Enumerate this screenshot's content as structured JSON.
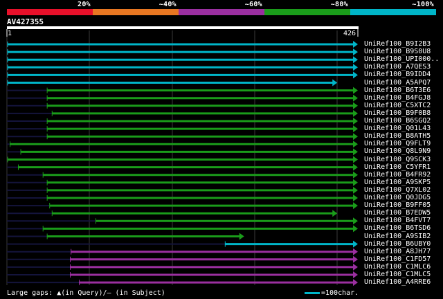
{
  "legend": {
    "segments": [
      {
        "label": "20%",
        "color": "#e8102a"
      },
      {
        "label": "~40%",
        "color": "#e87722"
      },
      {
        "label": "~60%",
        "color": "#9b2fa0"
      },
      {
        "label": "~80%",
        "color": "#1a9c1a"
      },
      {
        "label": "~100%",
        "color": "#00b5c8"
      }
    ]
  },
  "query": {
    "name": "AV427355",
    "start": "1",
    "end": "426"
  },
  "hits": [
    {
      "name": "UniRef100_B9I2B3",
      "color": "#00b5c8",
      "start": 1,
      "end": 426
    },
    {
      "name": "UniRef100_B9S0U8",
      "color": "#00b5c8",
      "start": 1,
      "end": 426
    },
    {
      "name": "UniRef100_UPI000..",
      "color": "#00b5c8",
      "start": 1,
      "end": 426
    },
    {
      "name": "UniRef100_A7QES3",
      "color": "#00b5c8",
      "start": 1,
      "end": 426
    },
    {
      "name": "UniRef100_B9IDD4",
      "color": "#00b5c8",
      "start": 1,
      "end": 426
    },
    {
      "name": "UniRef100_A5APQ7",
      "color": "#00b5c8",
      "start": 1,
      "end": 401
    },
    {
      "name": "UniRef100_B6T3E6",
      "color": "#1a9c1a",
      "start": 49,
      "end": 426
    },
    {
      "name": "UniRef100_B4FGJ8",
      "color": "#1a9c1a",
      "start": 49,
      "end": 426
    },
    {
      "name": "UniRef100_C5XTC2",
      "color": "#1a9c1a",
      "start": 49,
      "end": 426
    },
    {
      "name": "UniRef100_B9F0B8",
      "color": "#1a9c1a",
      "start": 55,
      "end": 426
    },
    {
      "name": "UniRef100_B6SGQ2",
      "color": "#1a9c1a",
      "start": 49,
      "end": 426
    },
    {
      "name": "UniRef100_Q01L43",
      "color": "#1a9c1a",
      "start": 49,
      "end": 426
    },
    {
      "name": "UniRef100_B8ATH5",
      "color": "#1a9c1a",
      "start": 49,
      "end": 426
    },
    {
      "name": "UniRef100_Q9FLT9",
      "color": "#1a9c1a",
      "start": 4,
      "end": 426
    },
    {
      "name": "UniRef100_Q8L9N9",
      "color": "#1a9c1a",
      "start": 17,
      "end": 426
    },
    {
      "name": "UniRef100_Q9SCK3",
      "color": "#1a9c1a",
      "start": 1,
      "end": 426
    },
    {
      "name": "UniRef100_C5YFR1",
      "color": "#1a9c1a",
      "start": 14,
      "end": 426
    },
    {
      "name": "UniRef100_B4FR92",
      "color": "#1a9c1a",
      "start": 44,
      "end": 426
    },
    {
      "name": "UniRef100_A9SKP5",
      "color": "#1a9c1a",
      "start": 49,
      "end": 426
    },
    {
      "name": "UniRef100_Q7XL02",
      "color": "#1a9c1a",
      "start": 49,
      "end": 426
    },
    {
      "name": "UniRef100_Q0JDG5",
      "color": "#1a9c1a",
      "start": 49,
      "end": 426
    },
    {
      "name": "UniRef100_B9FF05",
      "color": "#1a9c1a",
      "start": 52,
      "end": 426
    },
    {
      "name": "UniRef100_B7EDW5",
      "color": "#1a9c1a",
      "start": 55,
      "end": 401
    },
    {
      "name": "UniRef100_B4FVT7",
      "color": "#1a9c1a",
      "start": 108,
      "end": 426
    },
    {
      "name": "UniRef100_B6TSD6",
      "color": "#1a9c1a",
      "start": 44,
      "end": 426
    },
    {
      "name": "UniRef100_A9SIB2",
      "color": "#1a9c1a",
      "start": 49,
      "end": 288
    },
    {
      "name": "UniRef100_B6UBY0",
      "color": "#00b5c8",
      "start": 265,
      "end": 426
    },
    {
      "name": "UniRef100_A8JH77",
      "color": "#9b2fa0",
      "start": 78,
      "end": 426
    },
    {
      "name": "UniRef100_C1FD57",
      "color": "#9b2fa0",
      "start": 77,
      "end": 426
    },
    {
      "name": "UniRef100_C1MLC6",
      "color": "#9b2fa0",
      "start": 77,
      "end": 426
    },
    {
      "name": "UniRef100_C1MLC5",
      "color": "#9b2fa0",
      "start": 77,
      "end": 426
    },
    {
      "name": "UniRef100_A4RRE6",
      "color": "#9b2fa0",
      "start": 88,
      "end": 426
    }
  ],
  "footer": {
    "gaps_label": "Large gaps: ▲(in Query)/– (in Subject)",
    "scale_label": "=100char."
  }
}
